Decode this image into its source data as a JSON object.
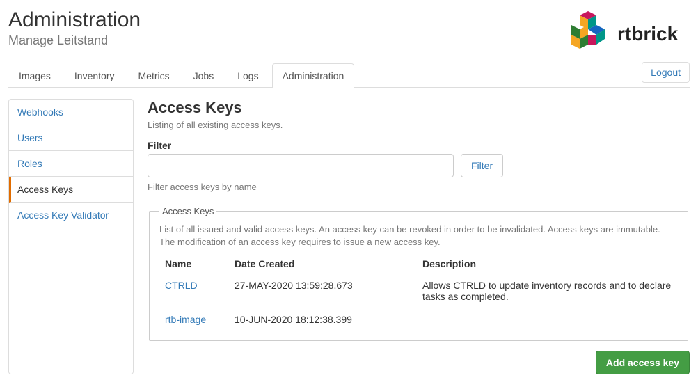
{
  "header": {
    "title": "Administration",
    "subtitle": "Manage Leitstand",
    "logo_text": "rtbrick"
  },
  "tabs": [
    {
      "label": "Images",
      "active": false
    },
    {
      "label": "Inventory",
      "active": false
    },
    {
      "label": "Metrics",
      "active": false
    },
    {
      "label": "Jobs",
      "active": false
    },
    {
      "label": "Logs",
      "active": false
    },
    {
      "label": "Administration",
      "active": true
    }
  ],
  "logout_label": "Logout",
  "sidebar": {
    "items": [
      {
        "label": "Webhooks",
        "active": false
      },
      {
        "label": "Users",
        "active": false
      },
      {
        "label": "Roles",
        "active": false
      },
      {
        "label": "Access Keys",
        "active": true
      },
      {
        "label": "Access Key Validator",
        "active": false
      }
    ]
  },
  "page": {
    "heading": "Access Keys",
    "description": "Listing of all existing access keys."
  },
  "filter": {
    "label": "Filter",
    "value": "",
    "button": "Filter",
    "help": "Filter access keys by name"
  },
  "keys_fieldset": {
    "legend": "Access Keys",
    "description": "List of all issued and valid access keys. An access key can be revoked in order to be invalidated. Access keys are immutable. The modification of an access key requires to issue a new access key.",
    "columns": {
      "name": "Name",
      "date": "Date Created",
      "desc": "Description"
    },
    "rows": [
      {
        "name": "CTRLD",
        "date": "27-MAY-2020 13:59:28.673",
        "desc": "Allows CTRLD to update inventory records and to declare tasks as completed."
      },
      {
        "name": "rtb-image",
        "date": "10-JUN-2020 18:12:38.399",
        "desc": ""
      }
    ]
  },
  "actions": {
    "add_key": "Add access key"
  }
}
